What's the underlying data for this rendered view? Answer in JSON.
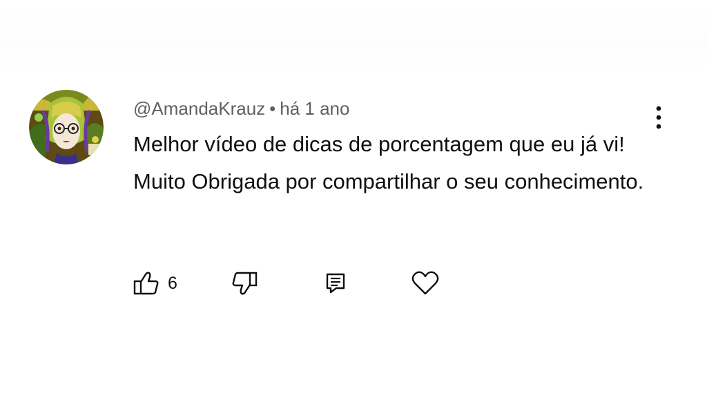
{
  "comment": {
    "author": "@AmandaKrauz",
    "separator": "•",
    "time": "há 1 ano",
    "text": "Melhor vídeo de dicas de porcentagem que eu já vi! Muito Obrigada por compartilhar o seu conhecimento.",
    "like_count": "6"
  },
  "icons": {
    "like": "thumbs-up-icon",
    "dislike": "thumbs-down-icon",
    "reply": "reply-comment-icon",
    "heart": "heart-icon",
    "menu": "more-vertical-icon"
  },
  "colors": {
    "text": "#0f0f0f",
    "meta": "#606060",
    "background": "#ffffff"
  }
}
